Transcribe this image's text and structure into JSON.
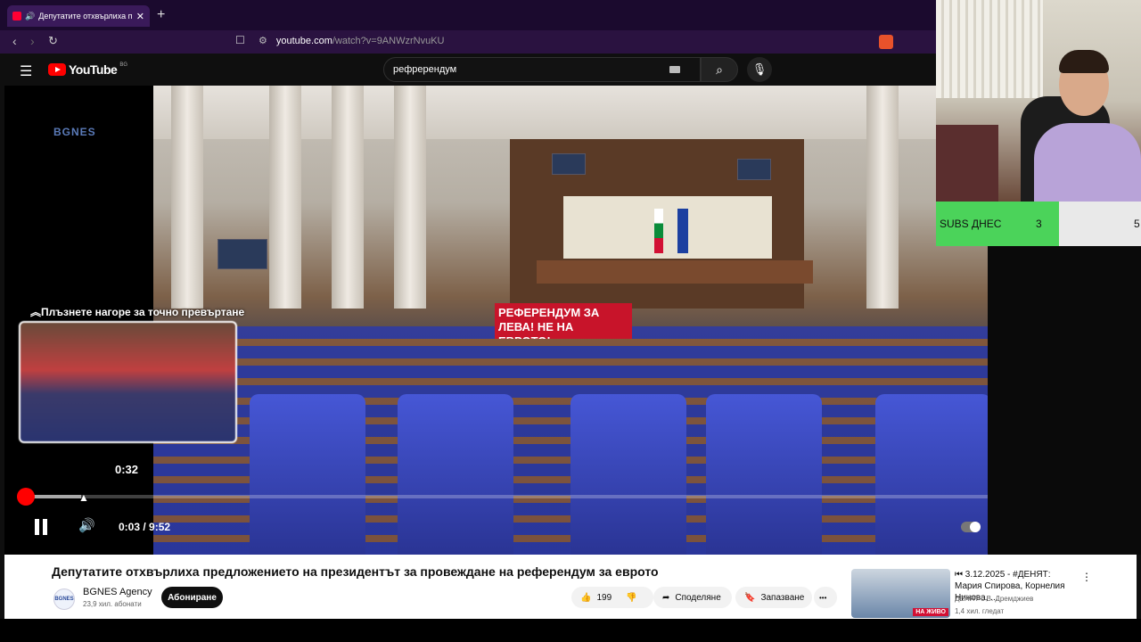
{
  "browser": {
    "tab_title": "Депутатите отхвърлиха пред...",
    "close_glyph": "✕",
    "new_tab_glyph": "+",
    "url_host": "youtube.com",
    "url_path": "/watch?v=9ANWzrNvuKU"
  },
  "youtube": {
    "logo_text": "YouTube",
    "country_code": "BG",
    "search_value": "рефререндум",
    "search_icon": "search-icon",
    "mic_icon": "mic-icon"
  },
  "video": {
    "watermark": "BGNES",
    "banner_text": "РЕФЕРЕНДУМ ЗА ЛЕВА! НЕ НА ЕВРОТО!",
    "seek_hint": "Плъзнете нагоре за точно превъртане",
    "preview_time": "0:32",
    "current_time": "0:03",
    "duration": "9:52",
    "time_separator": " / ",
    "progress_fraction": 0.005,
    "autoplay": true
  },
  "info": {
    "title": "Депутатите отхвърлиха предложението на президентът за провеждане на референдум за еврото",
    "channel_name": "BGNES Agency",
    "channel_avatar_text": "BGNES",
    "subscribers": "23,9 хил. абонати",
    "subscribe_label": "Абониране",
    "likes": "199",
    "share_label": "Споделяне",
    "save_label": "Запазване",
    "more_glyph": "•••"
  },
  "recommendation": {
    "title": "⏮ 3.12.2025 - #ДЕНЯТ: Мария Спирова, Корнелия Нинова, ...",
    "channel": "ДЕНЯТ с В. Дремджиев",
    "views": "1,4 хил. гледат",
    "live_badge": "НА ЖИВО"
  },
  "stream_overlay": {
    "subs_label": "SUBS ДНЕС",
    "subs_current": "3",
    "subs_goal": "5",
    "subs_progress_fraction": 0.6
  },
  "colors": {
    "accent": "#ff0000",
    "subs_bar": "#4bd35a",
    "browser_bg": "#1b0a2e"
  }
}
